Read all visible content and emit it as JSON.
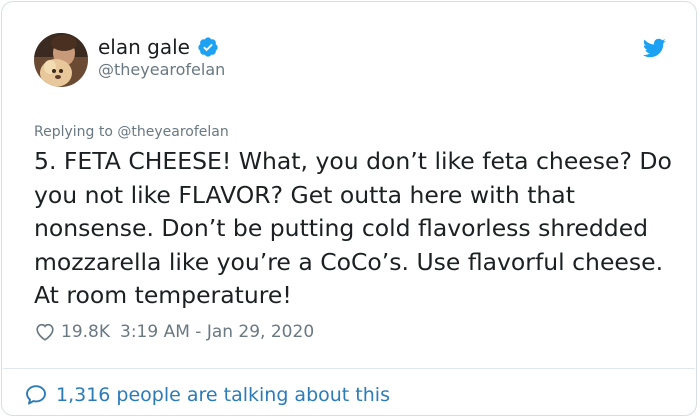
{
  "author": {
    "display_name": "elan gale",
    "handle": "@theyearofelan",
    "verified": true
  },
  "reply_context": "Replying to @theyearofelan",
  "tweet": {
    "text": "5. FETA CHEESE! What, you don’t like feta cheese? Do you not like FLAVOR? Get outta here with that nonsense. Don’t be putting cold flavorless shredded mozzarella like you’re a CoCo’s. Use flavorful cheese. At room temperature!",
    "likes": "19.8K",
    "timestamp": "3:19 AM - Jan 29, 2020"
  },
  "footer": {
    "talking_text": "1,316 people are talking about this"
  },
  "icons": {
    "verified": "verified-badge-icon",
    "brand": "twitter-bird-icon",
    "like": "heart-icon",
    "conversation": "speech-bubble-icon"
  },
  "colors": {
    "brand_blue": "#1da1f2",
    "link_blue": "#2b7bb9",
    "muted": "#697882",
    "text": "#1c2022"
  }
}
